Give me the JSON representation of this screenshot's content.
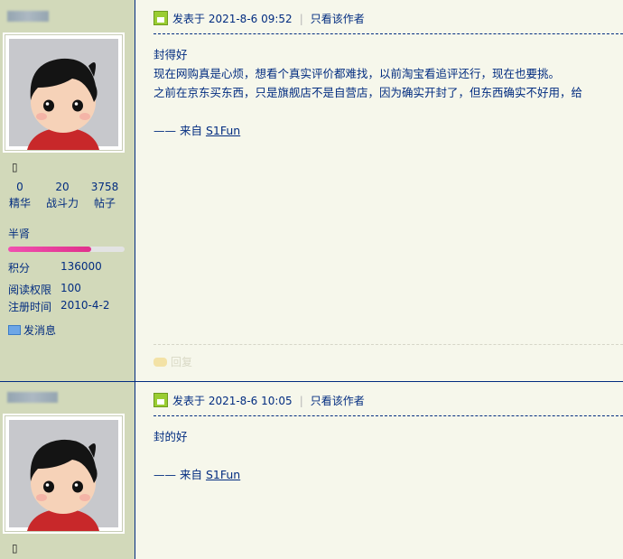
{
  "posts": [
    {
      "author_stats": {
        "digest": {
          "value": "0",
          "label": "精华"
        },
        "power": {
          "value": "20",
          "label": "战斗力"
        },
        "posts": {
          "value": "3758",
          "label": "帖子"
        }
      },
      "rank": "半肾",
      "rank_progress": 0.71,
      "info": [
        {
          "label": "积分",
          "value": "136000"
        },
        {
          "label": "阅读权限",
          "value": "100"
        },
        {
          "label": "注册时间",
          "value": "2010-4-2"
        }
      ],
      "message_label": "发消息",
      "posted_label": "发表于 2021-8-6 09:52",
      "author_only_label": "只看该作者",
      "body": [
        "封得好",
        "现在网购真是心烦，想看个真实评价都难找，以前淘宝看追评还行，现在也要挑。",
        "之前在京东买东西，只是旗舰店不是自营店，因为确实开封了，但东西确实不好用，给"
      ],
      "from_prefix": "—— 来自 ",
      "from_link": "S1Fun",
      "reply_label": "回复"
    },
    {
      "posted_label": "发表于 2021-8-6 10:05",
      "author_only_label": "只看该作者",
      "body": [
        "封的好"
      ],
      "from_prefix": "—— 来自 ",
      "from_link": "S1Fun"
    }
  ]
}
